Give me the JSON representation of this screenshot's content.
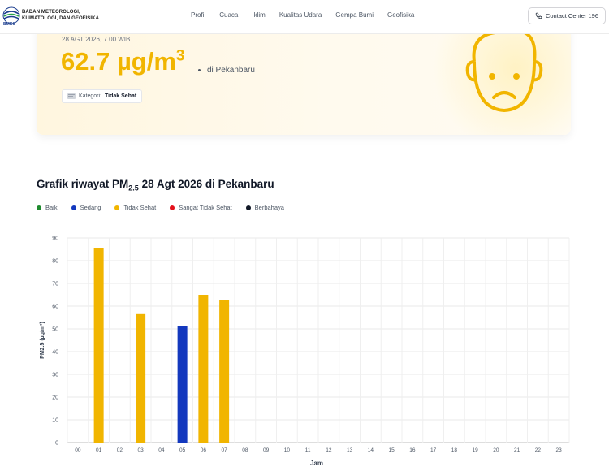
{
  "header": {
    "org_line1": "BADAN METEOROLOGI,",
    "org_line2": "KLIMATOLOGI, DAN GEOFISIKA",
    "logo_caption": "BMKG",
    "nav": [
      "Profil",
      "Cuaca",
      "Iklim",
      "Kualitas Udara",
      "Gempa Bumi",
      "Geofisika"
    ],
    "contact_label": "Contact Center 196"
  },
  "hero": {
    "date": "28 AGT 2026, 7.00 WIB",
    "value": "62.7 µg/m",
    "value_sup": "3",
    "location": "di Pekanbaru",
    "kategori_label": "Kategori:",
    "kategori_value": "Tidak Sehat",
    "accent": "#f1b500"
  },
  "chart": {
    "title_prefix": "Grafik riwayat PM",
    "title_sub": "2.5",
    "title_suffix": " 28 Agt 2026 di Pekanbaru"
  },
  "legend": [
    {
      "label": "Baik",
      "color": "#1f8a2e"
    },
    {
      "label": "Sedang",
      "color": "#1338be"
    },
    {
      "label": "Tidak Sehat",
      "color": "#f1b500"
    },
    {
      "label": "Sangat Tidak Sehat",
      "color": "#e3111b"
    },
    {
      "label": "Berbahaya",
      "color": "#111827"
    }
  ],
  "chart_data": {
    "type": "bar",
    "xlabel": "Jam",
    "ylabel": "PM2.5 (µg/m³)",
    "ylim": [
      0,
      90
    ],
    "yticks": [
      0,
      10,
      20,
      30,
      40,
      50,
      60,
      70,
      80,
      90
    ],
    "grid": true,
    "categories": [
      "00",
      "01",
      "02",
      "03",
      "04",
      "05",
      "06",
      "07",
      "08",
      "09",
      "10",
      "11",
      "12",
      "13",
      "14",
      "15",
      "16",
      "17",
      "18",
      "19",
      "20",
      "21",
      "22",
      "23"
    ],
    "values": [
      null,
      85.5,
      null,
      56.5,
      null,
      51.2,
      65.0,
      62.7,
      null,
      null,
      null,
      null,
      null,
      null,
      null,
      null,
      null,
      null,
      null,
      null,
      null,
      null,
      null,
      null
    ],
    "bar_colors": [
      null,
      "#f1b500",
      null,
      "#f1b500",
      null,
      "#1338be",
      "#f1b500",
      "#f1b500",
      null,
      null,
      null,
      null,
      null,
      null,
      null,
      null,
      null,
      null,
      null,
      null,
      null,
      null,
      null,
      null
    ]
  }
}
